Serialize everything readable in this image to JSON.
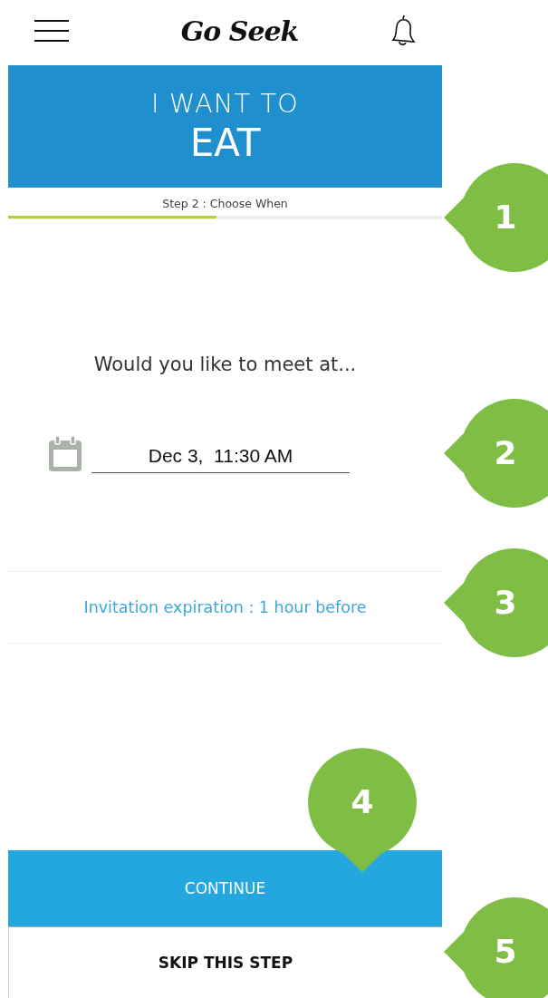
{
  "header": {
    "logo": "Go Seek"
  },
  "banner": {
    "line_1": "I WANT TO",
    "line_2": "EAT"
  },
  "progress": {
    "label": "Step 2 :  Choose When",
    "level": 0.48
  },
  "question": "Would you like to meet at...",
  "date_field": {
    "value": "Dec 3,  11:30 AM"
  },
  "expiration": "Invitation expiration : 1 hour before",
  "buttons": {
    "continue": "CONTINUE",
    "skip": "SKIP THIS STEP"
  },
  "callouts": [
    {
      "label": "1",
      "kind": "left"
    },
    {
      "label": "2",
      "kind": "left"
    },
    {
      "label": "3",
      "kind": "left"
    },
    {
      "label": "4",
      "kind": "down"
    },
    {
      "label": "5",
      "kind": "left"
    }
  ]
}
